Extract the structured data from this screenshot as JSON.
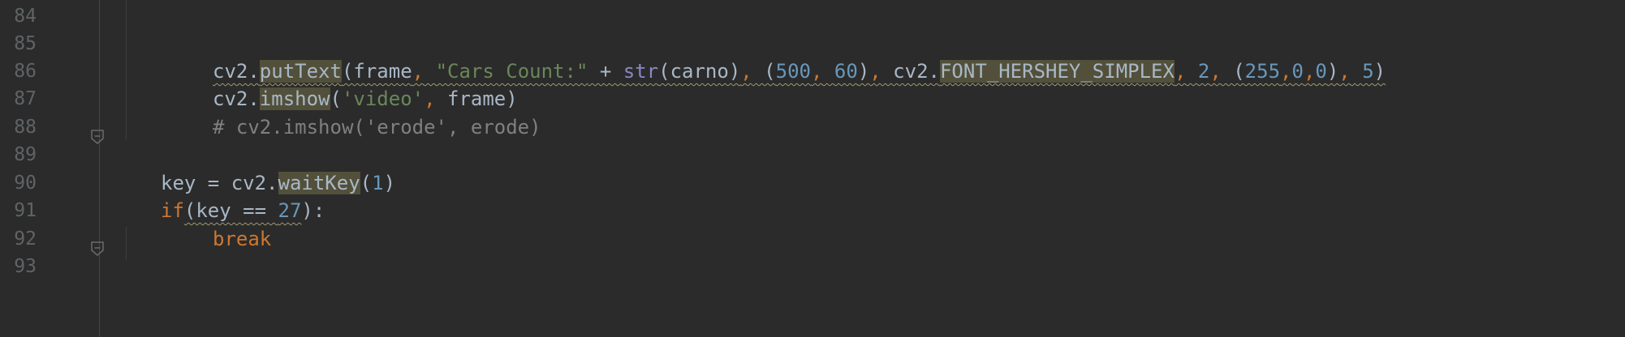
{
  "editor": {
    "line_numbers": [
      "84",
      "85",
      "86",
      "87",
      "88",
      "89",
      "90",
      "91",
      "92",
      "93"
    ],
    "lines": {
      "l86": {
        "a": "cv2.",
        "b": "putText",
        "c": "(frame",
        "d": ",",
        "e": " ",
        "f": "\"Cars Count:\"",
        "g": " + ",
        "h": "str",
        "i": "(carno)",
        "j": ",",
        "k": " (",
        "l": "500",
        "m": ",",
        "n": " ",
        "o": "60",
        "p": ")",
        "q": ",",
        "r": " cv2.",
        "s": "FONT_HERSHEY_SIMPLEX",
        "t": ",",
        "u": " ",
        "v": "2",
        "w": ",",
        "x": " (",
        "y": "255",
        "z": ",",
        "aa": "0",
        "ab": ",",
        "ac": "0",
        "ad": ")",
        "ae": ",",
        "af": " ",
        "ag": "5",
        "ah": ")"
      },
      "l87": {
        "a": "cv2.",
        "b": "imshow",
        "c": "(",
        "d": "'video'",
        "e": ",",
        "f": " frame)"
      },
      "l88": {
        "a": "# cv2.imshow('erode', erode)"
      },
      "l90": {
        "a": "key = cv2.",
        "b": "waitKey",
        "c": "(",
        "d": "1",
        "e": ")"
      },
      "l91": {
        "a": "if",
        "b": "(key == ",
        "c": "27",
        "d": "):"
      },
      "l92": {
        "a": "break"
      }
    }
  },
  "colors": {
    "background": "#2b2b2b",
    "keyword": "#cc7832",
    "string": "#6a8759",
    "number": "#6897bb",
    "builtin": "#8888c6",
    "comment": "#808080",
    "highlight": "#52503a",
    "line_number": "#606366"
  }
}
